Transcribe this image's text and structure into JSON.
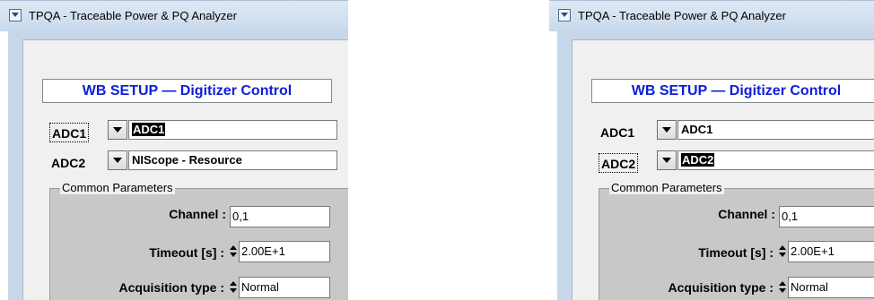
{
  "window": {
    "title": "TPQA - Traceable Power & PQ Analyzer"
  },
  "panels": [
    {
      "header": "WB SETUP — Digitizer Control",
      "adc1": {
        "label": "ADC1",
        "value": "ADC1",
        "label_focused": true,
        "value_selected": true
      },
      "adc2": {
        "label": "ADC2",
        "value": "NIScope - Resource",
        "label_focused": false,
        "value_selected": false
      },
      "group": {
        "title": "Common Parameters",
        "channel": {
          "label": "Channel",
          "value": "0,1"
        },
        "timeout": {
          "label": "Timeout [s]",
          "value": "2.00E+1"
        },
        "acquisition_type": {
          "label": "Acquisition type",
          "value": "Normal"
        }
      }
    },
    {
      "header": "WB SETUP — Digitizer Control",
      "adc1": {
        "label": "ADC1",
        "value": "ADC1",
        "label_focused": false,
        "value_selected": false
      },
      "adc2": {
        "label": "ADC2",
        "value": "ADC2",
        "label_focused": true,
        "value_selected": true
      },
      "group": {
        "title": "Common Parameters",
        "channel": {
          "label": "Channel",
          "value": "0,1"
        },
        "timeout": {
          "label": "Timeout [s]",
          "value": "2.00E+1"
        },
        "acquisition_type": {
          "label": "Acquisition type",
          "value": "Normal"
        }
      }
    }
  ],
  "colon": ":",
  "colors": {
    "header_text": "#0b1fd9",
    "selection_bg": "#000000",
    "titlebar": "#d4e1f0"
  }
}
